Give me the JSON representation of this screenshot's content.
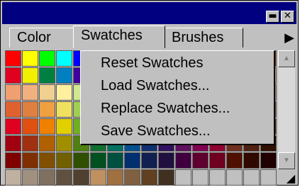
{
  "window": {
    "minimize_glyph": "▬",
    "close_glyph": "✕"
  },
  "tabs": [
    {
      "label": "Color",
      "active": false
    },
    {
      "label": "Swatches",
      "active": true
    },
    {
      "label": "Brushes",
      "active": false
    }
  ],
  "palette_menu_icon": "▶",
  "context_menu": {
    "items": [
      {
        "label": "Reset Swatches"
      },
      {
        "label": "Load Swatches..."
      },
      {
        "label": "Replace Swatches..."
      },
      {
        "label": "Save Swatches..."
      }
    ]
  },
  "scrollbar": {
    "up_icon": "▲",
    "down_icon": "▼"
  },
  "resize_grip_icon": "◢",
  "swatches": [
    [
      "#ff0000",
      "#ffff00",
      "#00ff00",
      "#00ffff",
      "#0000ff",
      "#ff00ff",
      "#ffffff",
      "#e0e0e0",
      "#c0c0c0",
      "#a0a0a0",
      "#808080",
      "#606060",
      "#404040",
      "#202020",
      "#000000",
      "#804000"
    ],
    [
      "#e0001f",
      "#f0f000",
      "#008040",
      "#0080c0",
      "#4000a0",
      "#800080",
      "#ff80ff",
      "#ffc0c0",
      "#ffe0c0",
      "#ffffc0",
      "#c0ffc0",
      "#c0ffff",
      "#c0c0ff",
      "#ffc0ff",
      "#e0c0a0",
      "#c0a080"
    ],
    [
      "#f0a070",
      "#f0b080",
      "#f0d090",
      "#fff0a0",
      "#d0e890",
      "#a0d890",
      "#90d0c0",
      "#90c0e0",
      "#90a0d8",
      "#a090d0",
      "#c090d0",
      "#e090c0",
      "#f090a0",
      "#d0a0a0",
      "#b09080",
      "#a08070"
    ],
    [
      "#e06030",
      "#e08040",
      "#f0a040",
      "#f0e060",
      "#a0d050",
      "#60c060",
      "#40b0a0",
      "#4090d0",
      "#5070c0",
      "#7050b0",
      "#a050b0",
      "#d050a0",
      "#e05070",
      "#b07060",
      "#906050",
      "#705040"
    ],
    [
      "#e00020",
      "#e05010",
      "#f08000",
      "#e0d000",
      "#70b020",
      "#20a040",
      "#00a090",
      "#0070c0",
      "#2040a0",
      "#502090",
      "#902090",
      "#c00070",
      "#d00040",
      "#905040",
      "#704030",
      "#503020"
    ],
    [
      "#a00010",
      "#a03010",
      "#b06000",
      "#a09000",
      "#508010",
      "#107030",
      "#007060",
      "#005090",
      "#103070",
      "#301060",
      "#601060",
      "#800050",
      "#900030",
      "#703020",
      "#502010",
      "#301000"
    ],
    [
      "#800000",
      "#803000",
      "#805000",
      "#706000",
      "#305000",
      "#005020",
      "#005040",
      "#003070",
      "#102050",
      "#201040",
      "#400040",
      "#600030",
      "#700020",
      "#501000",
      "#300800",
      "#200000"
    ],
    [
      "#c0b0a0",
      "#a09080",
      "#807060",
      "#605040",
      "#504030",
      "#c09060",
      "#a07040",
      "#806040",
      "#604020",
      "#403020",
      "#c0c0c0",
      "#c0c0c0",
      "#c0c0c0",
      "#c0c0c0",
      "#c0c0c0",
      "#c0c0c0"
    ]
  ]
}
